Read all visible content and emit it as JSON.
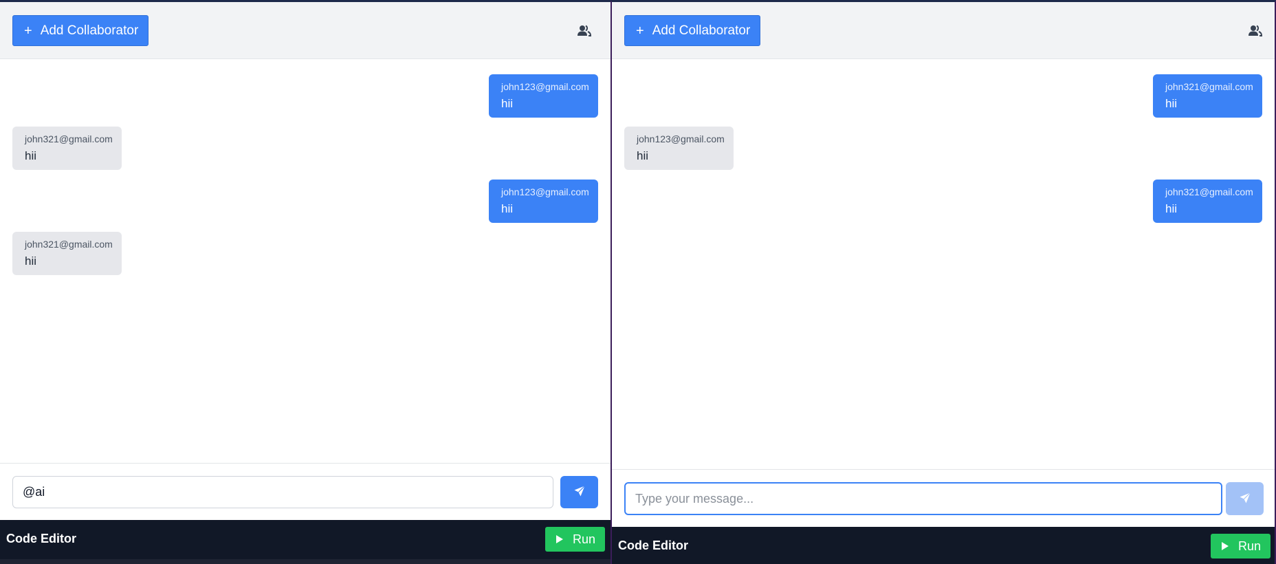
{
  "left": {
    "add_collaborator_label": "Add Collaborator",
    "plus_glyph": "+",
    "messages": [
      {
        "sender": "john123@gmail.com",
        "text": "hii",
        "direction": "outgoing"
      },
      {
        "sender": "john321@gmail.com",
        "text": "hii",
        "direction": "incoming"
      },
      {
        "sender": "john123@gmail.com",
        "text": "hii",
        "direction": "outgoing"
      },
      {
        "sender": "john321@gmail.com",
        "text": "hii",
        "direction": "incoming"
      }
    ],
    "input_value": "@ai",
    "input_placeholder": "Type your message...",
    "editor_title": "Code Editor",
    "run_label": "Run"
  },
  "right": {
    "add_collaborator_label": "Add Collaborator",
    "plus_glyph": "+",
    "messages": [
      {
        "sender": "john321@gmail.com",
        "text": "hii",
        "direction": "outgoing"
      },
      {
        "sender": "john123@gmail.com",
        "text": "hii",
        "direction": "incoming"
      },
      {
        "sender": "john321@gmail.com",
        "text": "hii",
        "direction": "outgoing"
      }
    ],
    "input_value": "",
    "input_placeholder": "Type your message...",
    "editor_title": "Code Editor",
    "run_label": "Run"
  },
  "icons": {
    "add": "plus-icon",
    "collaborators": "users-icon",
    "send": "send-icon",
    "run": "play-icon"
  },
  "colors": {
    "primary": "#3b82f6",
    "primary_disabled": "#a3c2f7",
    "incoming_bubble": "#e6e7eb",
    "editor_bar": "#111827",
    "run": "#22c55e",
    "header_bg": "#f2f3f5"
  }
}
